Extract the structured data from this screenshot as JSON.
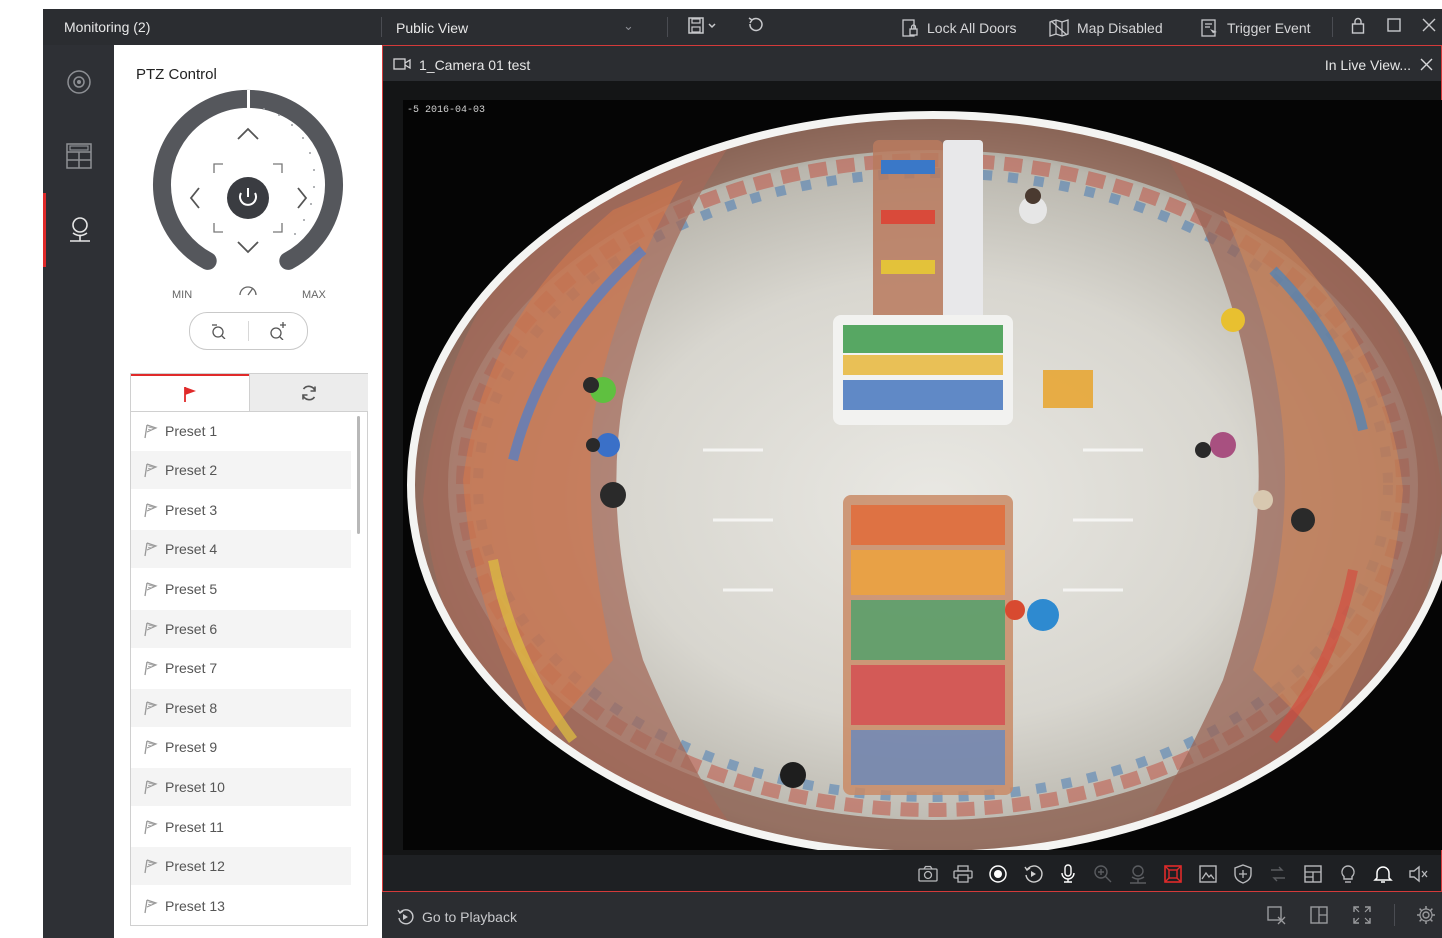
{
  "topbar": {
    "title": "Monitoring (2)",
    "view_name": "Public View",
    "lock_all_doors": "Lock All Doors",
    "map_disabled": "Map Disabled",
    "trigger_event": "Trigger Event"
  },
  "ptz": {
    "title": "PTZ Control",
    "min_label": "MIN",
    "max_label": "MAX",
    "presets": [
      "Preset 1",
      "Preset 2",
      "Preset 3",
      "Preset 4",
      "Preset 5",
      "Preset 6",
      "Preset 7",
      "Preset 8",
      "Preset 9",
      "Preset 10",
      "Preset 11",
      "Preset 12",
      "Preset 13"
    ]
  },
  "video": {
    "camera_name": "1_Camera 01 test",
    "status": "In Live View...",
    "timestamp_overlay": "-5 2016-04-03"
  },
  "bottom": {
    "go_to_playback": "Go to Playback"
  },
  "colors": {
    "accent": "#e02a2a",
    "chrome_dark": "#2b2d31",
    "panel_bg": "#ffffff"
  },
  "icons": {
    "nav": [
      "live-view-icon",
      "layout-grid-icon",
      "camera-person-icon"
    ],
    "controls": [
      "capture-icon",
      "print-icon",
      "record-icon",
      "instant-playback-icon",
      "microphone-icon",
      "zoom-icon",
      "ptz-person-icon",
      "fisheye-icon",
      "image-icon",
      "arming-icon",
      "switch-stream-icon",
      "window-layout-icon",
      "light-icon",
      "alarm-bell-icon",
      "mute-icon"
    ]
  }
}
